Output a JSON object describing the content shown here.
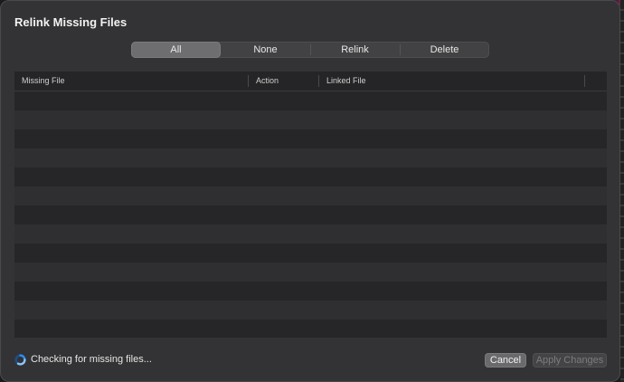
{
  "dialog": {
    "title": "Relink Missing Files"
  },
  "filter": {
    "options": [
      "All",
      "None",
      "Relink",
      "Delete"
    ],
    "selected": "All"
  },
  "table": {
    "columns": [
      "Missing File",
      "Action",
      "Linked File"
    ],
    "rows": []
  },
  "status": {
    "text": "Checking for missing files...",
    "icon": "spinner-icon"
  },
  "buttons": {
    "cancel": "Cancel",
    "apply": "Apply Changes"
  },
  "colors": {
    "dialog_bg": "#333335",
    "selected_segment": "#6e6e70",
    "spinner_blue": "#2d8cf0"
  }
}
